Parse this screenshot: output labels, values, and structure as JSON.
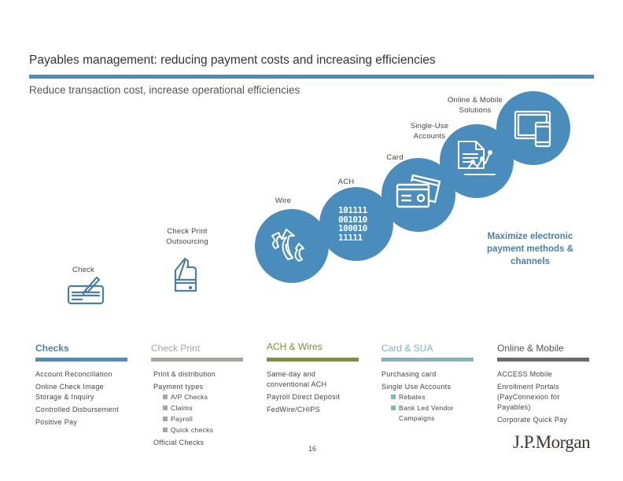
{
  "header": {
    "title": "Payables management: reducing payment costs and increasing efficiencies",
    "subtitle": "Reduce transaction cost, increase operational efficiencies",
    "accent_color": "#4a8dbd"
  },
  "steps": [
    {
      "label_lines": [
        "Check"
      ],
      "icon": "check-pen-icon",
      "style": "outline"
    },
    {
      "label_lines": [
        "Check Print",
        "Outsourcing"
      ],
      "icon": "printer-icon",
      "style": "outline"
    },
    {
      "label_lines": [
        "Wire"
      ],
      "icon": "curved-arrows-icon",
      "style": "circle"
    },
    {
      "label_lines": [
        "ACH"
      ],
      "icon": "binary-code-icon",
      "style": "circle",
      "binary": [
        "101111",
        "001010",
        "100010",
        "11111"
      ]
    },
    {
      "label_lines": [
        "Card"
      ],
      "icon": "credit-cards-icon",
      "style": "circle"
    },
    {
      "label_lines": [
        "Single-Use",
        "Accounts"
      ],
      "icon": "document-chart-icon",
      "style": "circle"
    },
    {
      "label_lines": [
        "Online & Mobile",
        "Solutions"
      ],
      "icon": "tablet-phone-icon",
      "style": "circle"
    }
  ],
  "callout": {
    "lines": [
      "Maximize electronic",
      "payment methods &",
      "channels"
    ],
    "color": "#4a7ea6"
  },
  "columns": [
    {
      "heading": "Checks",
      "heading_color": "#4f7f9f",
      "bar_color": "#4a8dbd",
      "heading_bold": true,
      "items": [
        {
          "text": "Account Reconciliation"
        },
        {
          "text": "Online Check Image Storage & Inquiry"
        },
        {
          "text": "Controlled Disbursement"
        },
        {
          "text": "Positive Pay"
        }
      ]
    },
    {
      "heading": "Check Print",
      "heading_color": "#a8a5a1",
      "bar_color": "#a8a5a1",
      "heading_bold": false,
      "items": [
        {
          "text": "Print & distribution"
        },
        {
          "text": "Payment types",
          "subitems": [
            "A/P Checks",
            "Claims",
            "Payroll",
            "Quick checks"
          ]
        },
        {
          "text": "Official Checks"
        }
      ]
    },
    {
      "heading": "ACH & Wires",
      "heading_color": "#7f8a3a",
      "bar_color": "#858d3c",
      "heading_bold": false,
      "items": [
        {
          "text": "Same-day and conventional ACH"
        },
        {
          "text": "Payroll Direct Deposit"
        },
        {
          "text": "FedWire/CHIPS"
        }
      ]
    },
    {
      "heading": "Card & SUA",
      "heading_color": "#7fb1bc",
      "bar_color": "#80b5bf",
      "heading_bold": false,
      "items": [
        {
          "text": "Purchasing card"
        },
        {
          "text": "Single Use Accounts",
          "subitems": [
            "Rebates",
            "Bank Led Vendor Campaigns"
          ]
        }
      ]
    },
    {
      "heading": "Online & Mobile",
      "heading_color": "#555555",
      "bar_color": "#6b6b6b",
      "heading_bold": false,
      "items": [
        {
          "text": "ACCESS Mobile"
        },
        {
          "text": "Enrollment Portals (PayConnexion for Payables)"
        },
        {
          "text": "Corporate Quick Pay"
        }
      ]
    }
  ],
  "footer": {
    "page_number": "16",
    "logo_text": "J.P.Morgan"
  }
}
